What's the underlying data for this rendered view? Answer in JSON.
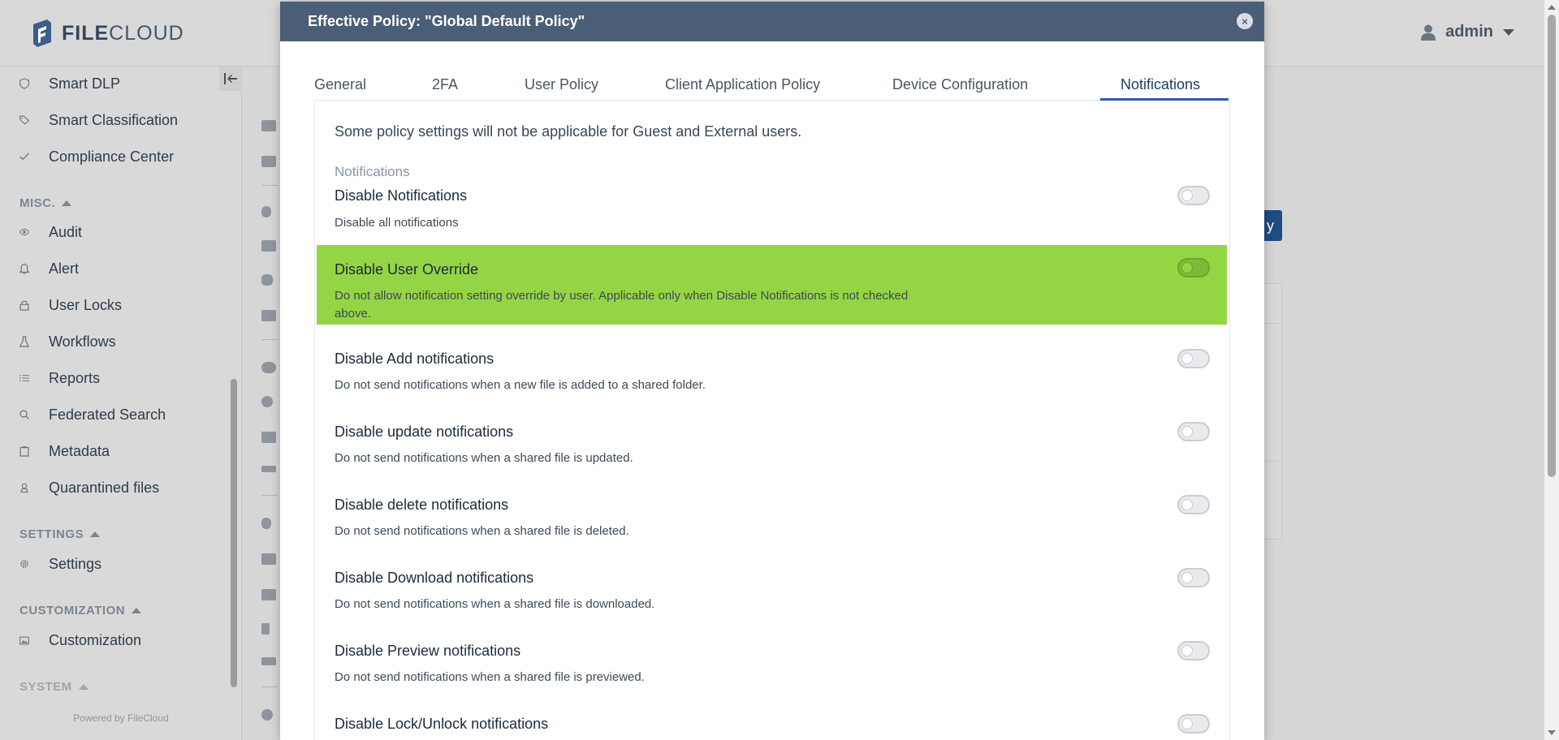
{
  "app": {
    "logo_bold": "FILE",
    "logo_light": "CLOUD",
    "user_name": "admin",
    "powered_by": "Powered by FileCloud"
  },
  "sidebar": {
    "items_top": [
      {
        "label": "Smart DLP",
        "icon": "shield-icon"
      },
      {
        "label": "Smart Classification",
        "icon": "tag-icon"
      },
      {
        "label": "Compliance Center",
        "icon": "check-icon"
      }
    ],
    "misc_label": "MISC.",
    "misc_items": [
      {
        "label": "Audit",
        "icon": "eye-icon"
      },
      {
        "label": "Alert",
        "icon": "bell-icon"
      },
      {
        "label": "User Locks",
        "icon": "lock-icon"
      },
      {
        "label": "Workflows",
        "icon": "flask-icon"
      },
      {
        "label": "Reports",
        "icon": "list-icon"
      },
      {
        "label": "Federated Search",
        "icon": "search-icon"
      },
      {
        "label": "Metadata",
        "icon": "clipboard-icon"
      },
      {
        "label": "Quarantined files",
        "icon": "biohazard-icon"
      }
    ],
    "settings_label": "SETTINGS",
    "settings_items": [
      {
        "label": "Settings",
        "icon": "gear-icon"
      }
    ],
    "customization_label": "CUSTOMIZATION",
    "customization_items": [
      {
        "label": "Customization",
        "icon": "image-icon"
      }
    ],
    "system_label": "SYSTEM"
  },
  "background": {
    "button_label_fragment": "y"
  },
  "modal": {
    "title": "Effective Policy: \"Global Default Policy\"",
    "close_label": "×",
    "tabs": [
      {
        "label": "General"
      },
      {
        "label": "2FA"
      },
      {
        "label": "User Policy"
      },
      {
        "label": "Client Application Policy"
      },
      {
        "label": "Device Configuration"
      },
      {
        "label": "Notifications",
        "active": true
      }
    ],
    "note": "Some policy settings will not be applicable for Guest and External users.",
    "group_label": "Notifications",
    "settings": [
      {
        "title": "Disable Notifications",
        "desc": "Disable all notifications",
        "enabled": false
      },
      {
        "title": "Disable User Override",
        "desc": "Do not allow notification setting override by user. Applicable only when Disable Notifications is not checked above.",
        "enabled": false,
        "highlighted": true
      },
      {
        "title": "Disable Add notifications",
        "desc": "Do not send notifications when a new file is added to a shared folder.",
        "enabled": false
      },
      {
        "title": "Disable update notifications",
        "desc": "Do not send notifications when a shared file is updated.",
        "enabled": false
      },
      {
        "title": "Disable delete notifications",
        "desc": "Do not send notifications when a shared file is deleted.",
        "enabled": false
      },
      {
        "title": "Disable Download notifications",
        "desc": "Do not send notifications when a shared file is downloaded.",
        "enabled": false
      },
      {
        "title": "Disable Preview notifications",
        "desc": "Do not send notifications when a shared file is previewed.",
        "enabled": false
      },
      {
        "title": "Disable Lock/Unlock notifications",
        "desc": "",
        "enabled": false
      }
    ]
  },
  "colors": {
    "modal_header": "#4b5e78",
    "highlight_row": "#94d545",
    "active_tab_underline": "#2a5ea8"
  }
}
